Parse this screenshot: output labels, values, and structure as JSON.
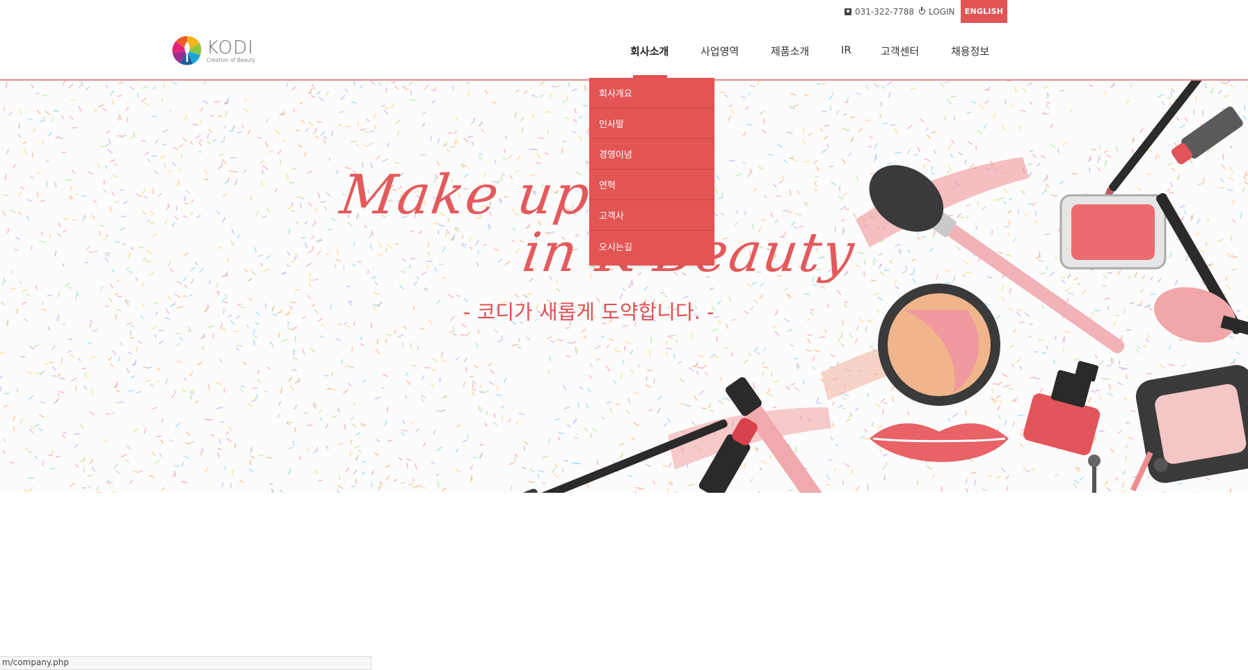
{
  "topbar": {
    "phone": "031-322-7788",
    "phone_icon": "phone-icon",
    "login_label": "LOGIN",
    "login_icon": "power-icon",
    "english_label": "ENGLISH"
  },
  "brand": {
    "name": "KODI",
    "tagline": "Creation of Beauty",
    "accent_color": "#e35455"
  },
  "nav": {
    "items": [
      {
        "label": "회사소개",
        "active": true
      },
      {
        "label": "사업영역"
      },
      {
        "label": "제품소개"
      },
      {
        "label": "IR"
      },
      {
        "label": "고객센터"
      },
      {
        "label": "채용정보"
      }
    ]
  },
  "dropdown": {
    "items": [
      "회사개요",
      "인사말",
      "경영이념",
      "연혁",
      "고객사",
      "오시는길"
    ]
  },
  "hero": {
    "script_line1": "Make up",
    "script_line2": "in K-Beauty",
    "subtitle": "- 코디가 새롭게 도약합니다. -"
  },
  "statusbar": {
    "url": "m/company.php"
  }
}
